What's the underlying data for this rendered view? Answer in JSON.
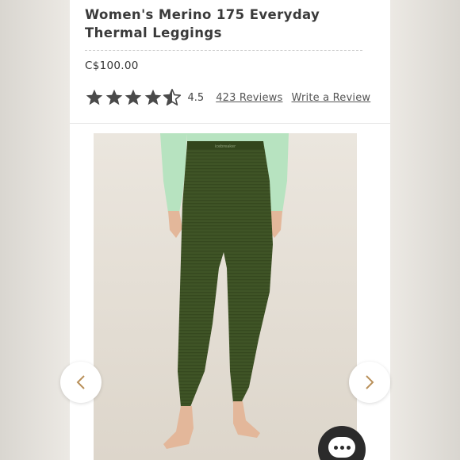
{
  "product": {
    "title": "Women's Merino 175 Everyday Thermal Leggings",
    "price": "C$100.00",
    "rating": {
      "value": "4.5",
      "stars_filled": 4.5,
      "stars_total": 5,
      "reviews_label": "423 Reviews",
      "write_review_label": "Write a Review"
    },
    "image": {
      "icon": "product-photo-leggings",
      "waistband_text": "icebreaker"
    }
  },
  "gallery": {
    "prev_icon": "chevron-left-icon",
    "next_icon": "chevron-right-icon"
  },
  "chat": {
    "icon": "chat-bubble-icon"
  },
  "colors": {
    "star": "#4a4a4a",
    "star_empty": "#d9d9d9",
    "legging_green": "#3f5426",
    "top_mint": "#b7e3c0",
    "chevron": "#b9905a",
    "chat_bg": "#2b2b2b"
  }
}
